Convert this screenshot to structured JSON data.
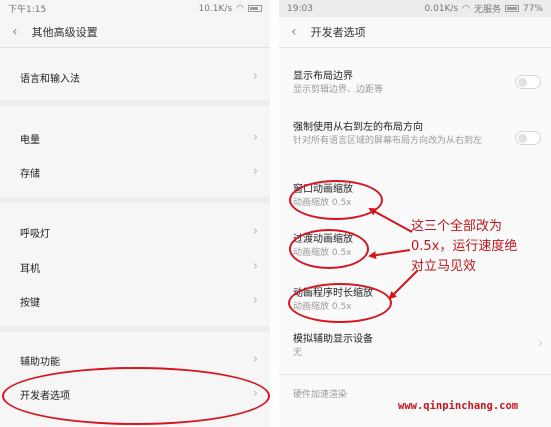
{
  "left": {
    "status": {
      "time": "下午1:15",
      "speed": "10.1K/s"
    },
    "title": "其他高级设置",
    "items": [
      {
        "label": "语言和输入法"
      },
      {
        "label": "电量"
      },
      {
        "label": "存储"
      },
      {
        "label": "呼吸灯"
      },
      {
        "label": "耳机"
      },
      {
        "label": "按键"
      },
      {
        "label": "辅助功能"
      },
      {
        "label": "开发者选项"
      }
    ]
  },
  "right": {
    "status": {
      "time": "19:03",
      "speed": "0.01K/s",
      "carrier": "无服务",
      "battery": "77%"
    },
    "title": "开发者选项",
    "items": [
      {
        "label": "显示布局边界",
        "sub": "显示剪辑边界、边距等",
        "toggle": false
      },
      {
        "label": "强制使用从右到左的布局方向",
        "sub": "针对所有语言区域的屏幕布局方向改为从右到左",
        "toggle": false
      },
      {
        "label": "窗口动画缩放",
        "sub": "动画缩放 0.5x"
      },
      {
        "label": "过渡动画缩放",
        "sub": "动画缩放 0.5x"
      },
      {
        "label": "动画程序时长缩放",
        "sub": "动画缩放 0.5x"
      },
      {
        "label": "模拟辅助显示设备",
        "sub": "无"
      },
      {
        "label": "硬件加速渲染",
        "sub": ""
      }
    ]
  },
  "annotation": {
    "lines": [
      "这三个全部改为",
      "0.5x，运行速度绝",
      "对立马见效"
    ],
    "color": "#d8141f"
  },
  "watermark": "www.qinpinchang.com"
}
